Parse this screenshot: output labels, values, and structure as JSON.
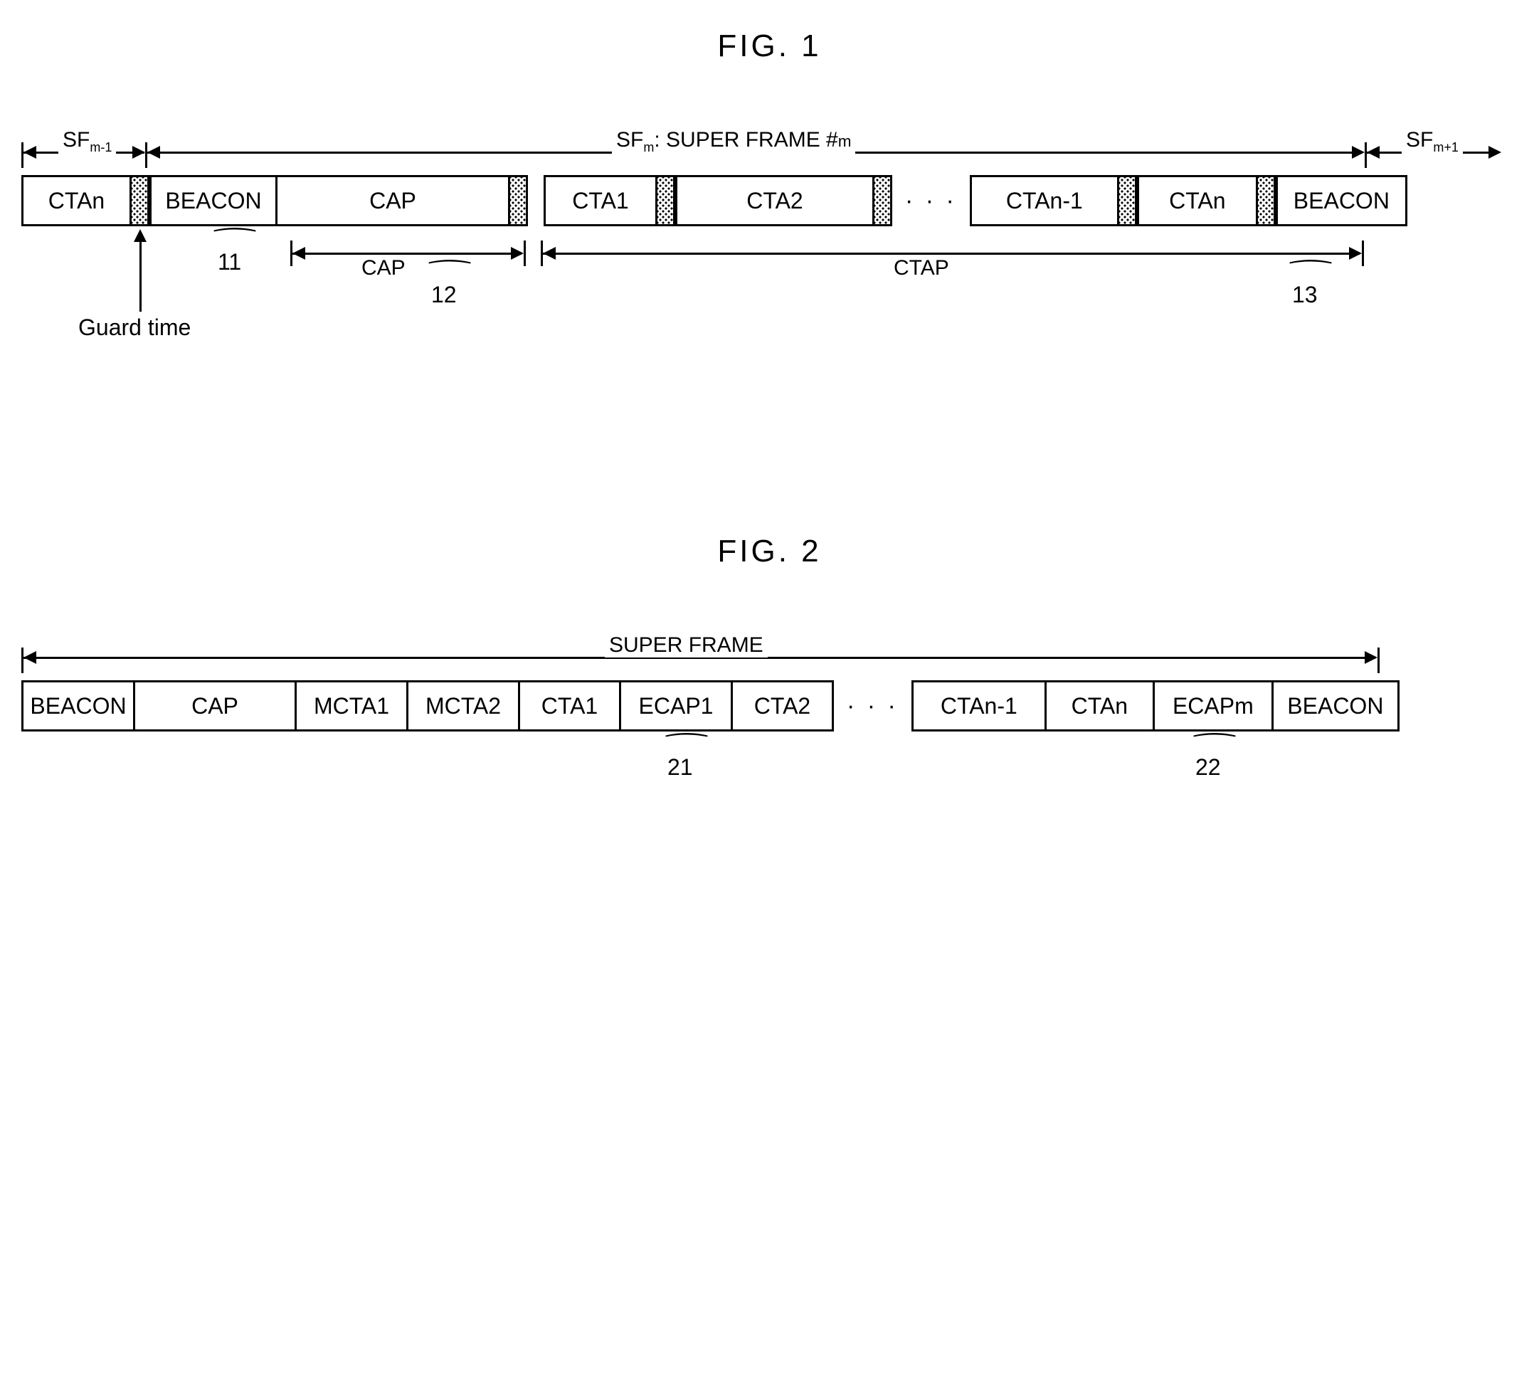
{
  "fig1": {
    "title": "FIG. 1",
    "top": {
      "sf_prev": "SFₘ₋₁",
      "sf_main": "SFₘ: SUPER FRAME #m",
      "sf_next": "SFₘ₊₁"
    },
    "cells": {
      "ctan_prev": "CTAn",
      "beacon1": "BEACON",
      "cap": "CAP",
      "cta1": "CTA1",
      "cta2": "CTA2",
      "dots": "· · ·",
      "ctan_1": "CTAn-1",
      "ctan": "CTAn",
      "beacon2": "BEACON"
    },
    "bottom": {
      "cap_label": "CAP",
      "ctap_label": "CTAP",
      "guard_time": "Guard time",
      "ref11": "11",
      "ref12": "12",
      "ref13": "13"
    }
  },
  "fig2": {
    "title": "FIG. 2",
    "top": {
      "superframe": "SUPER FRAME"
    },
    "cells": {
      "beacon1": "BEACON",
      "cap": "CAP",
      "mcta1": "MCTA1",
      "mcta2": "MCTA2",
      "cta1": "CTA1",
      "ecap1": "ECAP1",
      "cta2": "CTA2",
      "dots": "· · ·",
      "ctan_1": "CTAn-1",
      "ctan": "CTAn",
      "ecapm": "ECAPm",
      "beacon2": "BEACON"
    },
    "bottom": {
      "ref21": "21",
      "ref22": "22"
    }
  }
}
